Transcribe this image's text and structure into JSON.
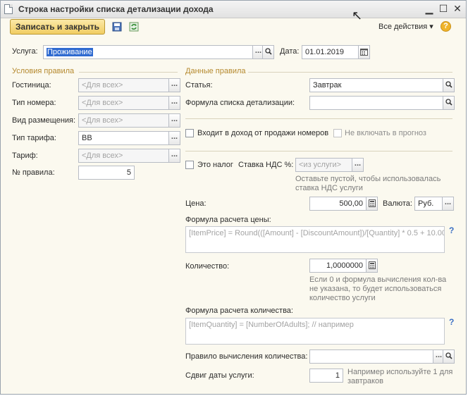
{
  "window": {
    "title": "Строка настройки списка детализации дохода"
  },
  "toolbar": {
    "save_close": "Записать и закрыть",
    "all_actions": "Все действия ▾",
    "help": "?"
  },
  "service": {
    "label": "Услуга:",
    "value": "Проживание"
  },
  "date": {
    "label": "Дата:",
    "value": "01.01.2019"
  },
  "conditions": {
    "title": "Условия правила",
    "hotel": {
      "label": "Гостиница:",
      "placeholder": "<Для всех>"
    },
    "room_type": {
      "label": "Тип номера:",
      "placeholder": "<Для всех>"
    },
    "accommodation": {
      "label": "Вид размещения:",
      "placeholder": "<Для всех>"
    },
    "rate_type": {
      "label": "Тип тарифа:",
      "value": "BB"
    },
    "rate": {
      "label": "Тариф:",
      "placeholder": "<Для всех>"
    },
    "rule_no": {
      "label": "№ правила:",
      "value": "5"
    }
  },
  "rule": {
    "title": "Данные правила",
    "article": {
      "label": "Статья:",
      "value": "Завтрак"
    },
    "detail_formula": {
      "label": "Формула списка детализации:",
      "value": ""
    },
    "room_sales": {
      "label": "Входит в доход от продажи номеров"
    },
    "no_forecast": {
      "label": "Не включать в прогноз"
    },
    "is_tax": {
      "label": "Это налог"
    },
    "vat": {
      "label": "Ставка НДС %:",
      "placeholder": "<из услуги>",
      "hint_line1": "Оставьте пустой, чтобы использовалась",
      "hint_line2": "ставка НДС услуги"
    },
    "price": {
      "label": "Цена:",
      "value": "500,00"
    },
    "currency": {
      "label": "Валюта:",
      "value": "Руб."
    },
    "price_formula": {
      "label": "Формула расчета цены:",
      "placeholder": "[ItemPrice] = Round(([Amount] - [DiscountAmount])/[Quantity] * 0.5 + 10.00..."
    },
    "quantity": {
      "label": "Количество:",
      "value": "1,0000000",
      "hint_line1": "Если 0 и формула вычисления кол-ва",
      "hint_line2": "не указана, то будет использоваться",
      "hint_line3": "количество услуги"
    },
    "quantity_formula": {
      "label": "Формула расчета количества:",
      "placeholder": "[ItemQuantity] = [NumberOfAdults]; // например"
    },
    "quantity_rule": {
      "label": "Правило вычисления количества:",
      "value": ""
    },
    "date_shift": {
      "label": "Сдвиг даты услуги:",
      "value": "1",
      "hint_line1": "Например используйте 1 для",
      "hint_line2": "завтраков"
    }
  }
}
